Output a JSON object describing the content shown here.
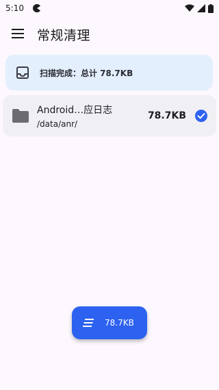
{
  "status_bar": {
    "time": "5:10",
    "icons": [
      "app-notification-icon",
      "wifi-icon",
      "signal-icon",
      "battery-icon"
    ]
  },
  "app_bar": {
    "menu_icon": "menu-icon",
    "title": "常规清理"
  },
  "scan_summary": {
    "icon": "inbox-icon",
    "text": "扫描完成：总计 78.7KB"
  },
  "files": [
    {
      "icon": "folder-icon",
      "name": "Android…应日志",
      "path": "/data/anr/",
      "size": "78.7KB",
      "selected": true
    }
  ],
  "fab": {
    "icon": "clean-icon",
    "label": "78.7KB"
  },
  "colors": {
    "background": "#fcf8fd",
    "scan_card": "#e3effc",
    "file_card": "#f0eff4",
    "accent": "#2d62f1"
  }
}
